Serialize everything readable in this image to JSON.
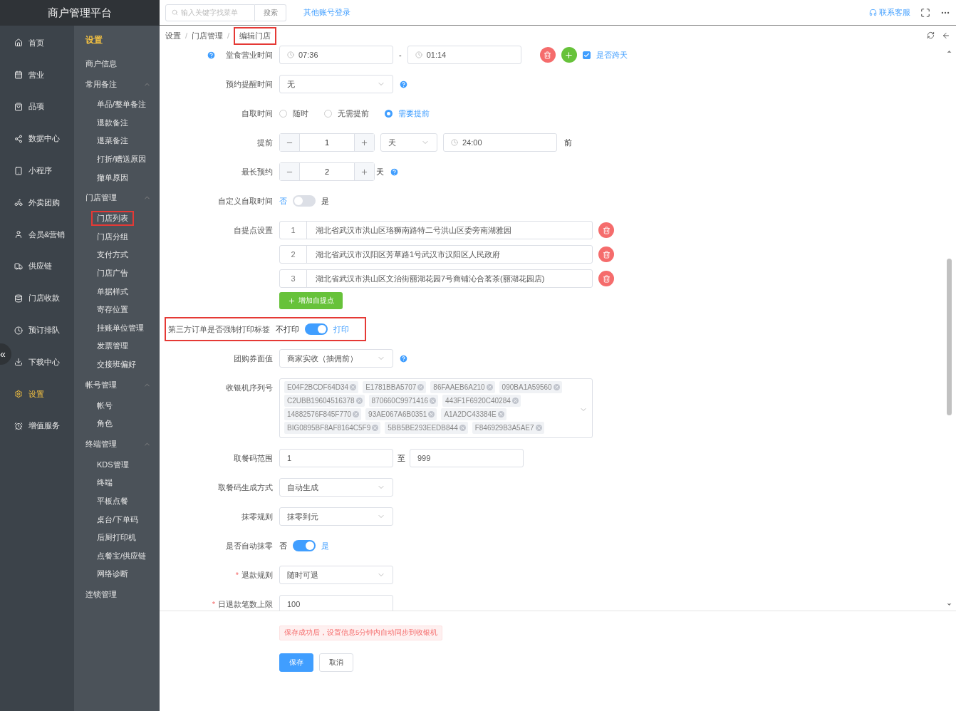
{
  "app_title": "商户管理平台",
  "rail": [
    {
      "label": "首页",
      "selected": false
    },
    {
      "label": "营业",
      "selected": false
    },
    {
      "label": "品项",
      "selected": false
    },
    {
      "label": "数据中心",
      "selected": false
    },
    {
      "label": "小程序",
      "selected": false
    },
    {
      "label": "外卖团购",
      "selected": false
    },
    {
      "label": "会员&营销",
      "selected": false
    },
    {
      "label": "供应链",
      "selected": false
    },
    {
      "label": "门店收款",
      "selected": false
    },
    {
      "label": "预订排队",
      "selected": false
    },
    {
      "label": "下载中心",
      "selected": false
    },
    {
      "label": "设置",
      "selected": true
    },
    {
      "label": "增值服务",
      "selected": false
    }
  ],
  "collapse_glyph": "«",
  "subnav": {
    "heading": "设置",
    "items": [
      {
        "label": "商户信息",
        "selected": false,
        "highlighted": false
      },
      {
        "label": "常用备注",
        "expanded": true,
        "children": [
          {
            "label": "单品/整单备注",
            "selected": false,
            "highlighted": false
          },
          {
            "label": "退款备注",
            "selected": false,
            "highlighted": false
          },
          {
            "label": "退菜备注",
            "selected": false,
            "highlighted": false
          },
          {
            "label": "打折/赠送原因",
            "selected": false,
            "highlighted": false
          },
          {
            "label": "撤单原因",
            "selected": false,
            "highlighted": false
          }
        ]
      },
      {
        "label": "门店管理",
        "expanded": true,
        "children": [
          {
            "label": "门店列表",
            "selected": false,
            "highlighted": true
          },
          {
            "label": "门店分组",
            "selected": false,
            "highlighted": false
          },
          {
            "label": "支付方式",
            "selected": false,
            "highlighted": false
          },
          {
            "label": "门店广告",
            "selected": false,
            "highlighted": false
          },
          {
            "label": "单据样式",
            "selected": false,
            "highlighted": false
          },
          {
            "label": "寄存位置",
            "selected": false,
            "highlighted": false
          },
          {
            "label": "挂账单位管理",
            "selected": false,
            "highlighted": false
          },
          {
            "label": "发票管理",
            "selected": false,
            "highlighted": false
          },
          {
            "label": "交接班偏好",
            "selected": false,
            "highlighted": false
          }
        ]
      },
      {
        "label": "帐号管理",
        "expanded": true,
        "children": [
          {
            "label": "帐号",
            "selected": false,
            "highlighted": false
          },
          {
            "label": "角色",
            "selected": false,
            "highlighted": false
          }
        ]
      },
      {
        "label": "终端管理",
        "expanded": true,
        "children": [
          {
            "label": "KDS管理",
            "selected": false,
            "highlighted": false
          },
          {
            "label": "终端",
            "selected": false,
            "highlighted": false
          },
          {
            "label": "平板点餐",
            "selected": false,
            "highlighted": false
          },
          {
            "label": "桌台/下单码",
            "selected": false,
            "highlighted": false
          },
          {
            "label": "后厨打印机",
            "selected": false,
            "highlighted": false
          },
          {
            "label": "点餐宝/供应链",
            "selected": false,
            "highlighted": false
          },
          {
            "label": "网络诊断",
            "selected": false,
            "highlighted": false
          }
        ]
      },
      {
        "label": "连锁管理",
        "selected": false,
        "highlighted": false
      }
    ]
  },
  "topbar": {
    "search": {
      "placeholder": "输入关键字找菜单"
    },
    "search_button": "搜索",
    "switch_account": "其他账号登录",
    "support": "联系客服"
  },
  "breadcrumb": [
    {
      "label": "设置",
      "highlighted": false
    },
    {
      "label": "门店管理",
      "highlighted": false
    },
    {
      "label": "编辑门店",
      "highlighted": true
    }
  ],
  "breadcrumb_separator": "/",
  "form": [
    {
      "kind": "time_range",
      "label": "堂食营业时间",
      "help": true,
      "start": "07:36",
      "separator": "-",
      "end": "01:14",
      "checkbox": {
        "label": "是否跨天",
        "checked": true
      }
    },
    {
      "kind": "select",
      "label": "预约提醒时间",
      "value": "无",
      "help": true
    },
    {
      "kind": "radio",
      "label": "自取时间",
      "options": [
        {
          "label": "随时",
          "selected": false
        },
        {
          "label": "无需提前",
          "selected": false
        },
        {
          "label": "需要提前",
          "selected": true
        }
      ]
    },
    {
      "kind": "advance",
      "label": "提前",
      "value": "1",
      "unit": "天",
      "time": "24:00",
      "suffix": "前"
    },
    {
      "kind": "stepper",
      "label": "最长预约",
      "value": "2",
      "suffix": "天",
      "help": true
    },
    {
      "kind": "switch",
      "label": "自定义自取时间",
      "off_label": "否",
      "on_label": "是",
      "on": false
    },
    {
      "kind": "points",
      "label": "自提点设置",
      "points": [
        {
          "index": "1",
          "address": "湖北省武汉市洪山区珞狮南路特二号洪山区委旁南湖雅园"
        },
        {
          "index": "2",
          "address": "湖北省武汉市汉阳区芳草路1号武汉市汉阳区人民政府"
        },
        {
          "index": "3",
          "address": "湖北省武汉市洪山区文治街丽湖花园7号商铺沁合茗茶(丽湖花园店)"
        }
      ],
      "add_button": "增加自提点"
    },
    {
      "kind": "switch",
      "label": "第三方订单是否强制打印标签",
      "off_label": "不打印",
      "on_label": "打印",
      "on": true,
      "highlighted": true
    },
    {
      "kind": "select",
      "label": "团购券面值",
      "value": "商家实收（抽佣前）",
      "help": true
    },
    {
      "kind": "tags",
      "label": "收银机序列号",
      "tags": [
        [
          "E04F2BCDF64D34",
          "E1781BBA5707",
          "86FAAEB6A210",
          "090BA1A59560"
        ],
        [
          "C2UBB19604516378",
          "870660C9971416",
          "443F1F6920C40284"
        ],
        [
          "14882576F845F770",
          "93AE067A6B0351",
          "A1A2DC43384E"
        ],
        [
          "BIG0895BF8AF8164C5F9",
          "5BB5BE293EEDB844",
          "F846929B3A5AE7"
        ]
      ]
    },
    {
      "kind": "range",
      "label": "取餐码范围",
      "from": "1",
      "separator": "至",
      "to": "999"
    },
    {
      "kind": "select",
      "label": "取餐码生成方式",
      "value": "自动生成"
    },
    {
      "kind": "select",
      "label": "抹零规则",
      "value": "抹零到元"
    },
    {
      "kind": "switch",
      "label": "是否自动抹零",
      "off_label": "否",
      "on_label": "是",
      "on": true
    },
    {
      "kind": "select",
      "label": "退款规则",
      "value": "随时可退",
      "required_mark": "*"
    },
    {
      "kind": "input",
      "label": "日退款笔数上限",
      "value": "100",
      "required_mark": "*"
    }
  ],
  "notice": "保存成功后，设置信息5分钟内自动同步到收银机",
  "buttons": [
    {
      "label": "保存",
      "kind": "primary"
    },
    {
      "label": "取消",
      "kind": "default"
    }
  ]
}
